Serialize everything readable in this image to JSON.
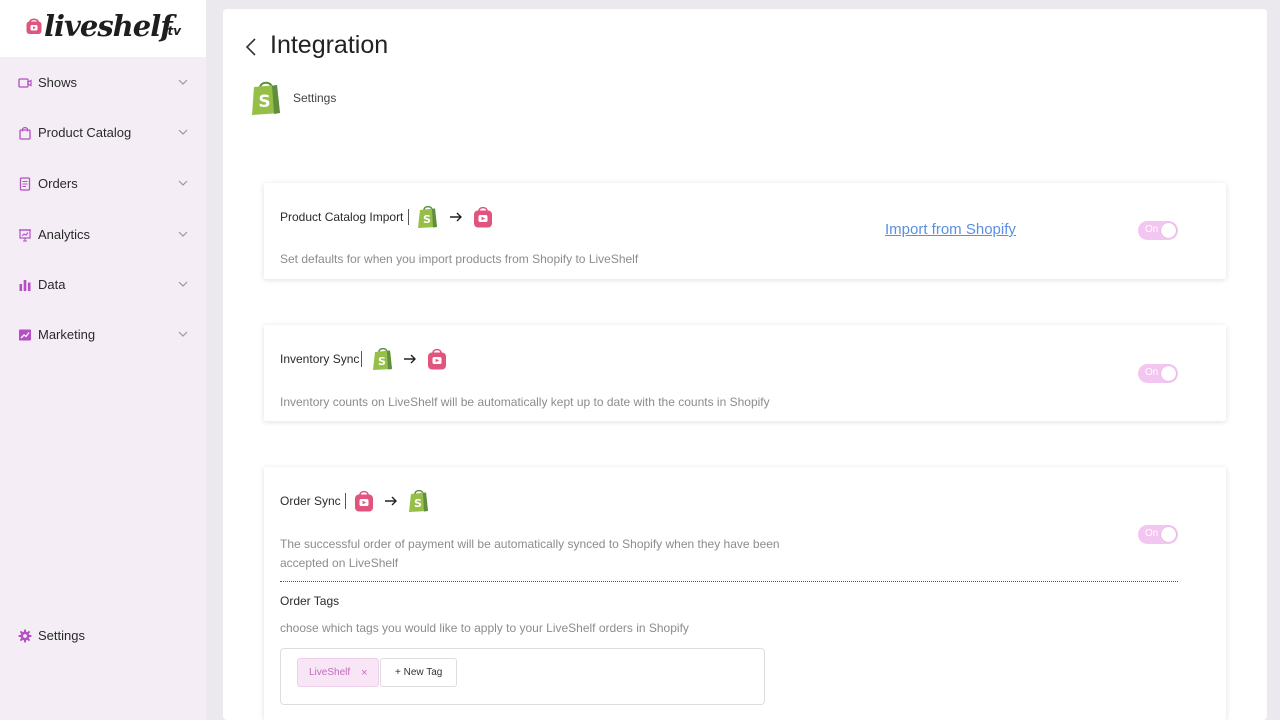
{
  "brand": {
    "name": "liveshelf",
    "suffix": ".tv",
    "accent": "#e0547e",
    "toggle_color": "#f2c6f0"
  },
  "sidebar": {
    "items": [
      {
        "label": "Shows",
        "icon": "video-icon"
      },
      {
        "label": "Product Catalog",
        "icon": "shopping-bag-icon"
      },
      {
        "label": "Orders",
        "icon": "document-icon"
      },
      {
        "label": "Analytics",
        "icon": "presentation-icon"
      },
      {
        "label": "Data",
        "icon": "bar-chart-icon"
      },
      {
        "label": "Marketing",
        "icon": "trend-chart-icon"
      }
    ],
    "settings_label": "Settings"
  },
  "header": {
    "title": "Integration",
    "crumb": "Settings"
  },
  "cards": {
    "catalog": {
      "title": "Product Catalog Import",
      "desc": "Set defaults for when you import products from Shopify to LiveShelf",
      "link": "Import from Shopify",
      "toggle": "On"
    },
    "inventory": {
      "title": "Inventory Sync",
      "desc": "Inventory counts on LiveShelf will be automatically kept up to date with the counts in Shopify",
      "toggle": "On"
    },
    "order": {
      "title": "Order Sync",
      "desc_line1": "The successful order of payment will be automatically synced to Shopify when they have been",
      "desc_line2": "accepted on LiveShelf",
      "toggle": "On",
      "tags_title": "Order Tags",
      "tags_desc": "choose which tags you would like to apply to your LiveShelf orders in Shopify",
      "tags": [
        {
          "label": "LiveShelf",
          "remove": "×"
        }
      ],
      "new_tag_label": "+ New Tag"
    }
  }
}
